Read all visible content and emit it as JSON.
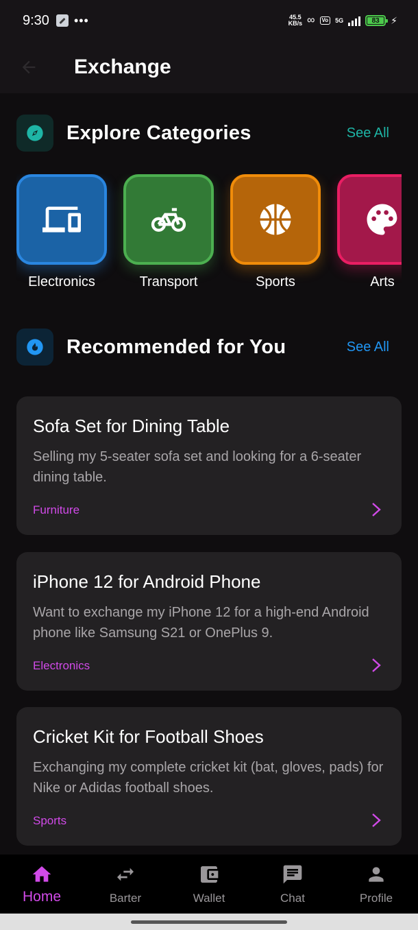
{
  "status_bar": {
    "time": "9:30",
    "dots": "•••",
    "net_speed_value": "45.5",
    "net_speed_unit": "KB/s",
    "vo_label": "Vo",
    "network": "5G",
    "battery": "83"
  },
  "app_bar": {
    "title": "Exchange"
  },
  "explore": {
    "title": "Explore Categories",
    "see_all": "See All",
    "accent": "#1eb5a6",
    "categories": [
      {
        "label": "Electronics",
        "color": "#2a86e0",
        "icon": "devices-icon"
      },
      {
        "label": "Transport",
        "color": "#4caf50",
        "icon": "bicycle-icon"
      },
      {
        "label": "Sports",
        "color": "#f08c0a",
        "icon": "basketball-icon"
      },
      {
        "label": "Arts",
        "color": "#e91e63",
        "icon": "palette-icon"
      }
    ]
  },
  "recommended": {
    "title": "Recommended for You",
    "see_all": "See All",
    "accent": "#2196f3",
    "items": [
      {
        "title": "Sofa Set for Dining Table",
        "description": "Selling my 5-seater sofa set and looking for a 6-seater dining table.",
        "category": "Furniture"
      },
      {
        "title": "iPhone 12 for Android Phone",
        "description": "Want to exchange my iPhone 12 for a high-end Android phone like Samsung S21 or OnePlus 9.",
        "category": "Electronics"
      },
      {
        "title": "Cricket Kit for Football Shoes",
        "description": "Exchanging my complete cricket kit (bat, gloves, pads) for Nike or Adidas football shoes.",
        "category": "Sports"
      }
    ]
  },
  "bottom_nav": {
    "active_color": "#d14ae8",
    "items": [
      {
        "label": "Home",
        "icon": "home-icon",
        "active": true
      },
      {
        "label": "Barter",
        "icon": "swap-icon",
        "active": false
      },
      {
        "label": "Wallet",
        "icon": "wallet-icon",
        "active": false
      },
      {
        "label": "Chat",
        "icon": "chat-icon",
        "active": false
      },
      {
        "label": "Profile",
        "icon": "person-icon",
        "active": false
      }
    ]
  }
}
